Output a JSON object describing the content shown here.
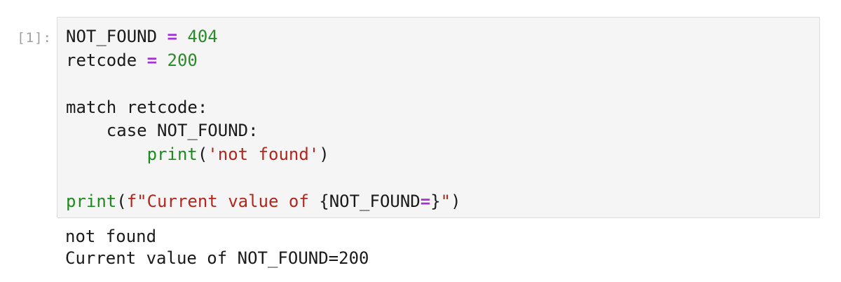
{
  "cell": {
    "prompt": "[1]:",
    "code_lines": [
      [
        {
          "text": "NOT_FOUND ",
          "kind": "plain"
        },
        {
          "text": "=",
          "kind": "op"
        },
        {
          "text": " ",
          "kind": "plain"
        },
        {
          "text": "404",
          "kind": "num"
        }
      ],
      [
        {
          "text": "retcode ",
          "kind": "plain"
        },
        {
          "text": "=",
          "kind": "op"
        },
        {
          "text": " ",
          "kind": "plain"
        },
        {
          "text": "200",
          "kind": "num"
        }
      ],
      [],
      [
        {
          "text": "match retcode:",
          "kind": "plain"
        }
      ],
      [
        {
          "text": "    case NOT_FOUND:",
          "kind": "plain"
        }
      ],
      [
        {
          "text": "        ",
          "kind": "plain"
        },
        {
          "text": "print",
          "kind": "builtin"
        },
        {
          "text": "(",
          "kind": "plain"
        },
        {
          "text": "'not found'",
          "kind": "str"
        },
        {
          "text": ")",
          "kind": "plain"
        }
      ],
      [],
      [
        {
          "text": "print",
          "kind": "builtin"
        },
        {
          "text": "(",
          "kind": "plain"
        },
        {
          "text": "f\"Current value of ",
          "kind": "str"
        },
        {
          "text": "{NOT_FOUND",
          "kind": "plain"
        },
        {
          "text": "=",
          "kind": "op"
        },
        {
          "text": "}",
          "kind": "plain"
        },
        {
          "text": "\"",
          "kind": "str"
        },
        {
          "text": ")",
          "kind": "plain"
        }
      ]
    ],
    "output_lines": [
      "not found",
      "Current value of NOT_FOUND=200"
    ]
  },
  "colors": {
    "operator": "#a433d6",
    "number": "#2b8a2b",
    "builtin": "#1d8a1d",
    "string": "#b3261e",
    "prompt": "#9e9e9e",
    "cell_background": "#f5f5f5",
    "cell_border": "#dcdcdc"
  }
}
